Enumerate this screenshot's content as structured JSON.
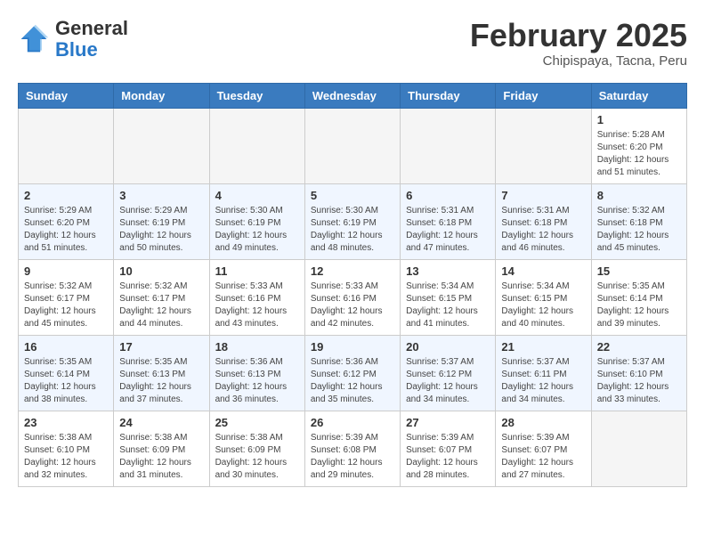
{
  "logo": {
    "general": "General",
    "blue": "Blue"
  },
  "title": "February 2025",
  "subtitle": "Chipispaya, Tacna, Peru",
  "days_of_week": [
    "Sunday",
    "Monday",
    "Tuesday",
    "Wednesday",
    "Thursday",
    "Friday",
    "Saturday"
  ],
  "weeks": [
    {
      "days": [
        {
          "num": "",
          "info": ""
        },
        {
          "num": "",
          "info": ""
        },
        {
          "num": "",
          "info": ""
        },
        {
          "num": "",
          "info": ""
        },
        {
          "num": "",
          "info": ""
        },
        {
          "num": "",
          "info": ""
        },
        {
          "num": "1",
          "info": "Sunrise: 5:28 AM\nSunset: 6:20 PM\nDaylight: 12 hours\nand 51 minutes."
        }
      ]
    },
    {
      "days": [
        {
          "num": "2",
          "info": "Sunrise: 5:29 AM\nSunset: 6:20 PM\nDaylight: 12 hours\nand 51 minutes."
        },
        {
          "num": "3",
          "info": "Sunrise: 5:29 AM\nSunset: 6:19 PM\nDaylight: 12 hours\nand 50 minutes."
        },
        {
          "num": "4",
          "info": "Sunrise: 5:30 AM\nSunset: 6:19 PM\nDaylight: 12 hours\nand 49 minutes."
        },
        {
          "num": "5",
          "info": "Sunrise: 5:30 AM\nSunset: 6:19 PM\nDaylight: 12 hours\nand 48 minutes."
        },
        {
          "num": "6",
          "info": "Sunrise: 5:31 AM\nSunset: 6:18 PM\nDaylight: 12 hours\nand 47 minutes."
        },
        {
          "num": "7",
          "info": "Sunrise: 5:31 AM\nSunset: 6:18 PM\nDaylight: 12 hours\nand 46 minutes."
        },
        {
          "num": "8",
          "info": "Sunrise: 5:32 AM\nSunset: 6:18 PM\nDaylight: 12 hours\nand 45 minutes."
        }
      ]
    },
    {
      "days": [
        {
          "num": "9",
          "info": "Sunrise: 5:32 AM\nSunset: 6:17 PM\nDaylight: 12 hours\nand 45 minutes."
        },
        {
          "num": "10",
          "info": "Sunrise: 5:32 AM\nSunset: 6:17 PM\nDaylight: 12 hours\nand 44 minutes."
        },
        {
          "num": "11",
          "info": "Sunrise: 5:33 AM\nSunset: 6:16 PM\nDaylight: 12 hours\nand 43 minutes."
        },
        {
          "num": "12",
          "info": "Sunrise: 5:33 AM\nSunset: 6:16 PM\nDaylight: 12 hours\nand 42 minutes."
        },
        {
          "num": "13",
          "info": "Sunrise: 5:34 AM\nSunset: 6:15 PM\nDaylight: 12 hours\nand 41 minutes."
        },
        {
          "num": "14",
          "info": "Sunrise: 5:34 AM\nSunset: 6:15 PM\nDaylight: 12 hours\nand 40 minutes."
        },
        {
          "num": "15",
          "info": "Sunrise: 5:35 AM\nSunset: 6:14 PM\nDaylight: 12 hours\nand 39 minutes."
        }
      ]
    },
    {
      "days": [
        {
          "num": "16",
          "info": "Sunrise: 5:35 AM\nSunset: 6:14 PM\nDaylight: 12 hours\nand 38 minutes."
        },
        {
          "num": "17",
          "info": "Sunrise: 5:35 AM\nSunset: 6:13 PM\nDaylight: 12 hours\nand 37 minutes."
        },
        {
          "num": "18",
          "info": "Sunrise: 5:36 AM\nSunset: 6:13 PM\nDaylight: 12 hours\nand 36 minutes."
        },
        {
          "num": "19",
          "info": "Sunrise: 5:36 AM\nSunset: 6:12 PM\nDaylight: 12 hours\nand 35 minutes."
        },
        {
          "num": "20",
          "info": "Sunrise: 5:37 AM\nSunset: 6:12 PM\nDaylight: 12 hours\nand 34 minutes."
        },
        {
          "num": "21",
          "info": "Sunrise: 5:37 AM\nSunset: 6:11 PM\nDaylight: 12 hours\nand 34 minutes."
        },
        {
          "num": "22",
          "info": "Sunrise: 5:37 AM\nSunset: 6:10 PM\nDaylight: 12 hours\nand 33 minutes."
        }
      ]
    },
    {
      "days": [
        {
          "num": "23",
          "info": "Sunrise: 5:38 AM\nSunset: 6:10 PM\nDaylight: 12 hours\nand 32 minutes."
        },
        {
          "num": "24",
          "info": "Sunrise: 5:38 AM\nSunset: 6:09 PM\nDaylight: 12 hours\nand 31 minutes."
        },
        {
          "num": "25",
          "info": "Sunrise: 5:38 AM\nSunset: 6:09 PM\nDaylight: 12 hours\nand 30 minutes."
        },
        {
          "num": "26",
          "info": "Sunrise: 5:39 AM\nSunset: 6:08 PM\nDaylight: 12 hours\nand 29 minutes."
        },
        {
          "num": "27",
          "info": "Sunrise: 5:39 AM\nSunset: 6:07 PM\nDaylight: 12 hours\nand 28 minutes."
        },
        {
          "num": "28",
          "info": "Sunrise: 5:39 AM\nSunset: 6:07 PM\nDaylight: 12 hours\nand 27 minutes."
        },
        {
          "num": "",
          "info": ""
        }
      ]
    }
  ]
}
